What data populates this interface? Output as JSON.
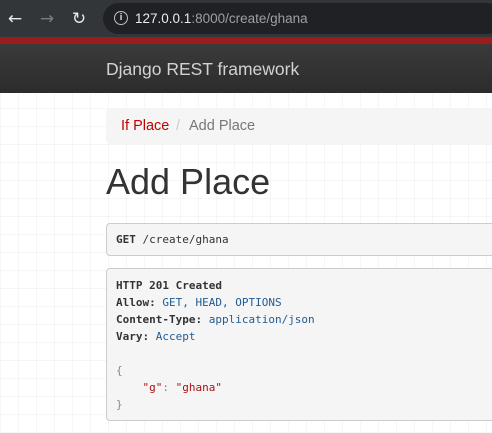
{
  "browser": {
    "url_host": "127.0.0.1",
    "url_rest": ":8000/create/ghana"
  },
  "navbar": {
    "brand": "Django REST framework"
  },
  "breadcrumb": {
    "items": [
      {
        "label": "If Place"
      },
      {
        "label": "Add Place"
      }
    ],
    "separator": "/"
  },
  "page": {
    "title": "Add Place"
  },
  "request": {
    "method": "GET",
    "path": "/create/ghana"
  },
  "response": {
    "status": "HTTP 201 Created",
    "headers": [
      {
        "name": "Allow:",
        "value": "GET, HEAD, OPTIONS"
      },
      {
        "name": "Content-Type:",
        "value": "application/json"
      },
      {
        "name": "Vary:",
        "value": "Accept"
      }
    ],
    "body": {
      "open": "{",
      "key": "\"g\"",
      "colon": ": ",
      "value": "\"ghana\"",
      "close": "}"
    }
  },
  "colors": {
    "accent": "#c20000",
    "navbar": "#2f2f2f",
    "strip": "#9b1c1c",
    "header_value": "#1f5b91",
    "json_string": "#aa1111"
  },
  "icons": {
    "back": "arrow-left",
    "forward": "arrow-right",
    "reload": "reload",
    "site_info": "info-circle"
  }
}
